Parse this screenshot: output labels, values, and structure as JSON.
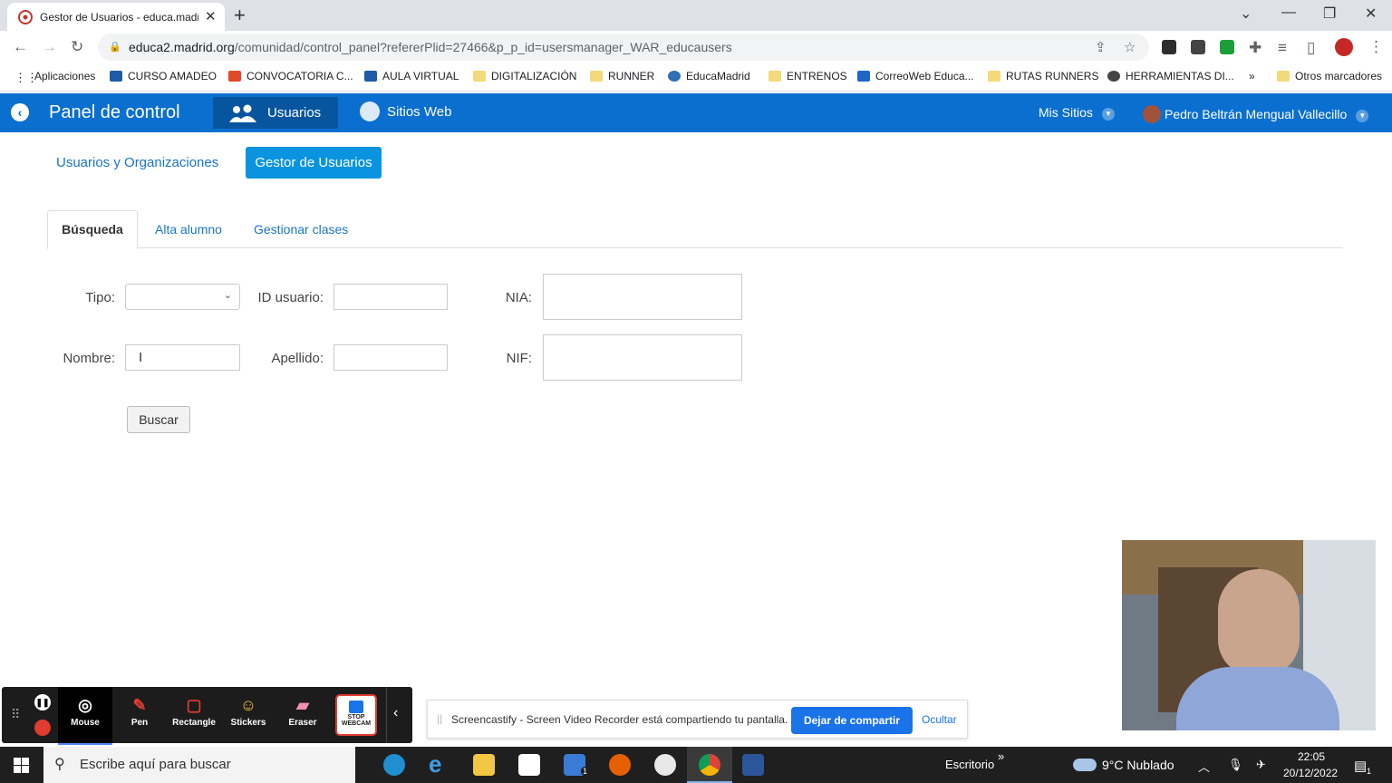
{
  "browser": {
    "tab_title": "Gestor de Usuarios - educa.madrid",
    "url_host": "educa2.madrid.org",
    "url_path": "/comunidad/control_panel?refererPlid=27466&p_p_id=usersmanager_WAR_educausers",
    "bookmarks": [
      {
        "label": "Aplicaciones",
        "icon": "apps-grid-icon"
      },
      {
        "label": "CURSO AMADEO",
        "icon": "graduation-cap-icon"
      },
      {
        "label": "CONVOCATORIA C...",
        "icon": "site-icon"
      },
      {
        "label": "AULA VIRTUAL",
        "icon": "graduation-cap-icon"
      },
      {
        "label": "DIGITALIZACIÓN",
        "icon": "folder-icon"
      },
      {
        "label": "RUNNER",
        "icon": "folder-icon"
      },
      {
        "label": "EducaMadrid",
        "icon": "globe-icon"
      },
      {
        "label": "ENTRENOS",
        "icon": "folder-icon"
      },
      {
        "label": "CorreoWeb Educa...",
        "icon": "mail-icon"
      },
      {
        "label": "RUTAS RUNNERS",
        "icon": "folder-icon"
      },
      {
        "label": "HERRAMIENTAS DI...",
        "icon": "globe-icon"
      }
    ],
    "bookmarks_overflow": "»",
    "other_bookmarks": "Otros marcadores"
  },
  "appbar": {
    "title": "Panel de control",
    "usuarios_label": "Usuarios",
    "sitios_label": "Sitios Web",
    "mis_sitios": "Mis Sitios",
    "user_name": "Pedro Beltrán Mengual Vallecillo"
  },
  "subnav": {
    "item1": "Usuarios y Organizaciones",
    "item2": "Gestor de Usuarios"
  },
  "tabs": {
    "busqueda": "Búsqueda",
    "alta": "Alta alumno",
    "gestionar": "Gestionar clases"
  },
  "form": {
    "tipo": "Tipo:",
    "id_usuario": "ID usuario:",
    "nia": "NIA:",
    "nombre": "Nombre:",
    "apellido": "Apellido:",
    "nif": "NIF:",
    "buscar": "Buscar"
  },
  "screencastify": {
    "tools": [
      "Mouse",
      "Pen",
      "Rectangle",
      "Stickers",
      "Eraser"
    ],
    "stop_webcam": "STOP WEBCAM",
    "share_message": "Screencastify - Screen Video Recorder está compartiendo tu pantalla.",
    "share_stop": "Dejar de compartir",
    "share_hide": "Ocultar"
  },
  "taskbar": {
    "search_placeholder": "Escribe aquí para buscar",
    "desktop": "Escritorio",
    "weather": "9°C  Nublado",
    "time": "22:05",
    "date": "20/12/2022",
    "mail_badge": "1",
    "notif_badge": "1"
  }
}
